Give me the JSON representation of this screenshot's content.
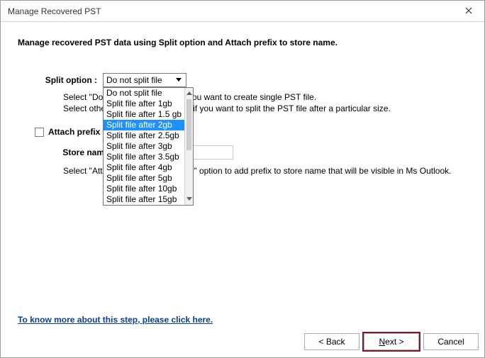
{
  "window": {
    "title": "Manage Recovered PST"
  },
  "heading": "Manage recovered PST data using Split option and Attach prefix to store name.",
  "split": {
    "label": "Split option :",
    "selected": "Do not split file",
    "options": [
      "Do not split file",
      "Split file after 1gb",
      "Split file after 1.5 gb",
      "Split file after 2gb",
      "Split file after 2.5gb",
      "Split file after 3gb",
      "Split file after 3.5gb",
      "Split file after 4gb",
      "Split file after 5gb",
      "Split file after 10gb",
      "Split file after 15gb"
    ],
    "hover_index": 3,
    "desc_line1": "Select \"Do not split file\" option, if you want to create single PST file.",
    "desc_line2": "Select other PST splitting options, if you want to split the PST file after a particular size."
  },
  "prefix": {
    "checkbox_label": "Attach prefix to store name :",
    "storename_label": "Store name :",
    "storename_value": "",
    "desc": "Select \"Attach prefix to store name\" option to add prefix to store name that will be visible in Ms Outlook."
  },
  "footer": {
    "help_link": "To know more about this step, please click here.",
    "back": "< Back",
    "next": "Next >",
    "cancel": "Cancel"
  }
}
